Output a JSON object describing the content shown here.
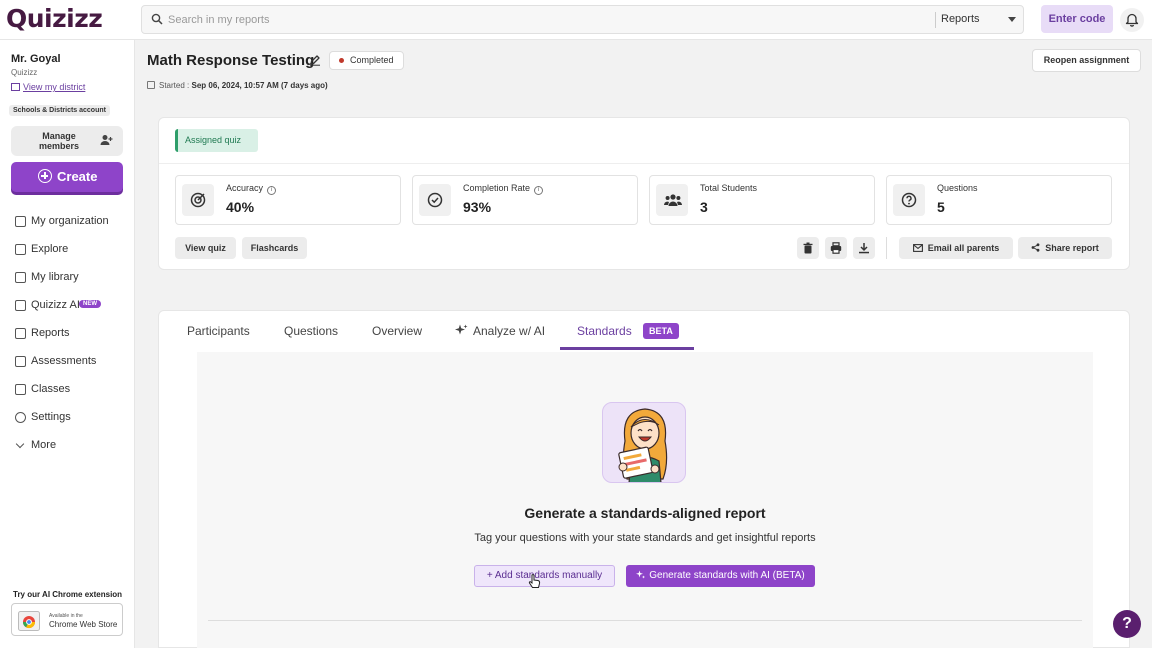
{
  "app": {
    "logo": "Quizizz"
  },
  "topbar": {
    "search_placeholder": "Search in my reports",
    "scope": "Reports",
    "enter_code": "Enter code"
  },
  "sidebar": {
    "teacher": "Mr. Goyal",
    "org": "Quizizz",
    "district_link": "View my district",
    "account_badge": "Schools & Districts account",
    "manage_members": "Manage members",
    "create": "Create",
    "items": [
      {
        "label": "My organization",
        "icon": "organization-icon"
      },
      {
        "label": "Explore",
        "icon": "explore-icon"
      },
      {
        "label": "My library",
        "icon": "library-icon"
      },
      {
        "label": "Quizizz AI",
        "icon": "sparkle-icon",
        "badge": "NEW"
      },
      {
        "label": "Reports",
        "icon": "reports-icon"
      },
      {
        "label": "Assessments",
        "icon": "assessments-icon"
      },
      {
        "label": "Classes",
        "icon": "classes-icon"
      },
      {
        "label": "Settings",
        "icon": "gear-icon"
      },
      {
        "label": "More",
        "icon": "chevron-down-icon"
      }
    ],
    "extension_title": "Try our AI Chrome extension",
    "chrome_store_line1": "Available in the",
    "chrome_store_line2": "Chrome Web Store"
  },
  "header": {
    "title": "Math Response Testing",
    "status": "Completed",
    "reopen": "Reopen assignment",
    "started_label": "Started :",
    "started_value": "Sep 06, 2024, 10:57 AM (7 days ago)"
  },
  "summary": {
    "tag": "Assigned quiz",
    "stats": [
      {
        "label": "Accuracy",
        "value": "40%",
        "icon": "target-icon",
        "info": true
      },
      {
        "label": "Completion Rate",
        "value": "93%",
        "icon": "check-circle-icon",
        "info": true
      },
      {
        "label": "Total Students",
        "value": "3",
        "icon": "students-icon",
        "info": false
      },
      {
        "label": "Questions",
        "value": "5",
        "icon": "question-icon",
        "info": false
      }
    ],
    "view_quiz": "View quiz",
    "flashcards": "Flashcards",
    "email_parents": "Email all parents",
    "share_report": "Share report"
  },
  "tabs": {
    "items": [
      "Participants",
      "Questions",
      "Overview",
      "Analyze w/ AI",
      "Standards"
    ],
    "active": "Standards",
    "beta": "BETA"
  },
  "standards": {
    "title": "Generate a standards-aligned report",
    "subtitle": "Tag your questions with your state standards and get insightful reports",
    "add_manual": "+ Add standards manually",
    "generate_ai": "Generate standards with AI (BETA)"
  },
  "colors": {
    "brand": "#8e44c9",
    "brand_dark": "#6b3fa0",
    "logo": "#461a42",
    "status_dot": "#c0392b",
    "tag_green": "#2e9e6a"
  }
}
